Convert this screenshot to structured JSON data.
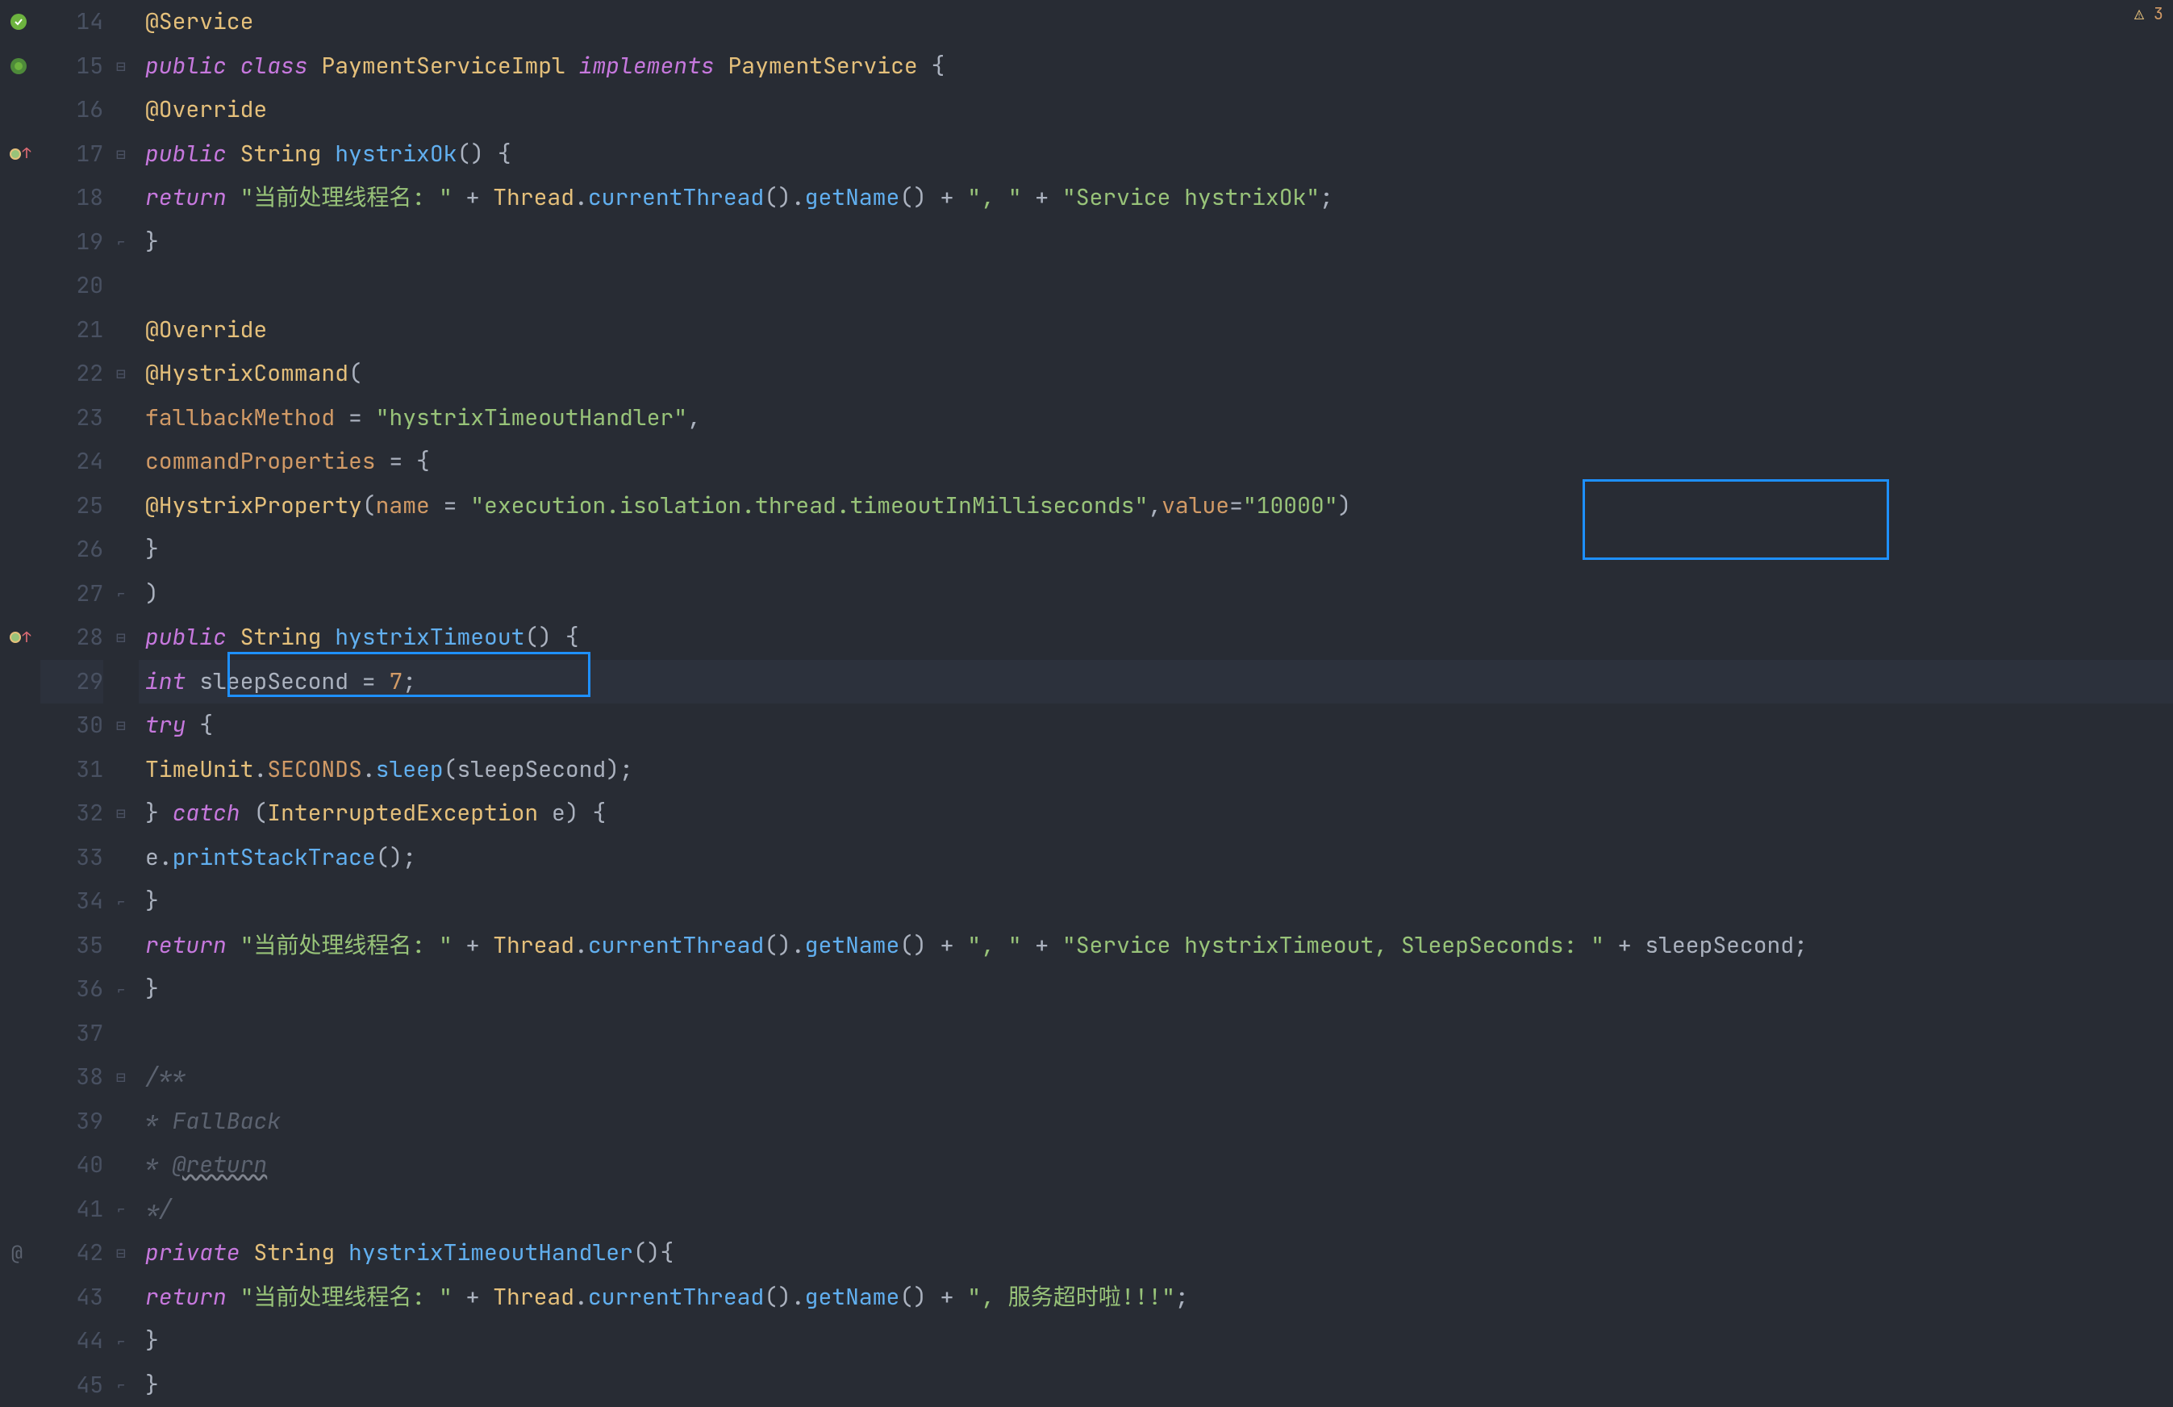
{
  "topRight": {
    "icon": "⚠",
    "count": "3"
  },
  "gutter": {
    "startLine": 14,
    "endLine": 45
  },
  "code": {
    "l14": {
      "anno": "@Service"
    },
    "l15": {
      "kw_public": "public",
      "kw_class": "class",
      "cls": "PaymentServiceImpl",
      "kw_impl": "implements",
      "iface": "PaymentService",
      "brace": " {"
    },
    "l16": {
      "anno": "@Override"
    },
    "l17": {
      "kw": "public",
      "type": "String",
      "fn": "hystrixOk",
      "rest": "() {"
    },
    "l18": {
      "kw": "return",
      "s1": "\"当前处理线程名: \"",
      "plus1": " + ",
      "t1": "Thread",
      "dot1": ".",
      "m1": "currentThread",
      "p1": "().",
      "m2": "getName",
      "p2": "() + ",
      "s2": "\", \"",
      "plus2": " + ",
      "s3": "\"Service hystrixOk\"",
      "semi": ";"
    },
    "l19": {
      "brace": "}"
    },
    "l21": {
      "anno": "@Override"
    },
    "l22": {
      "anno": "@HystrixCommand",
      "paren": "("
    },
    "l23": {
      "param": "fallbackMethod",
      "eq": " = ",
      "val": "\"hystrixTimeoutHandler\"",
      "comma": ","
    },
    "l24": {
      "param": "commandProperties",
      "eq": " = {",
      "brace": ""
    },
    "l25": {
      "anno": "@HystrixProperty",
      "open": "(",
      "p1": "name",
      "eq1": " = ",
      "v1": "\"execution.isolation.thread.timeoutInMilliseconds\"",
      "comma": ",",
      "p2": "value",
      "eq2": "=",
      "v2": "\"10000\"",
      "close": ")"
    },
    "l26": {
      "brace": "}"
    },
    "l27": {
      "paren": ")"
    },
    "l28": {
      "kw": "public",
      "type": "String",
      "fn": "hystrixTimeout",
      "rest": "() {"
    },
    "l29": {
      "kw": "int",
      "var": " sleepSecond = ",
      "num": "7",
      "semi": ";"
    },
    "l30": {
      "kw": "try",
      "brace": " {"
    },
    "l31": {
      "cls": "TimeUnit",
      "dot1": ".",
      "c2": "SECONDS",
      "dot2": ".",
      "fn": "sleep",
      "open": "(",
      "arg": "sleepSecond",
      "close": ");"
    },
    "l32": {
      "brace1": "} ",
      "kw": "catch",
      "open": " (",
      "type": "InterruptedException",
      "var": " e",
      "close": ") {"
    },
    "l33": {
      "var": "e",
      "dot": ".",
      "fn": "printStackTrace",
      "rest": "();"
    },
    "l34": {
      "brace": "}"
    },
    "l35": {
      "kw": "return",
      "s1": "\"当前处理线程名: \"",
      "plus1": " + ",
      "t1": "Thread",
      "dot1": ".",
      "m1": "currentThread",
      "p1": "().",
      "m2": "getName",
      "p2": "() + ",
      "s2": "\", \"",
      "plus2": " + ",
      "s3": "\"Service hystrixTimeout, SleepSeconds: \"",
      "plus3": " + sleepSecond;",
      "semi": ""
    },
    "l36": {
      "brace": "}"
    },
    "l38": {
      "cmt": "/**"
    },
    "l39": {
      "cmt": " * FallBack"
    },
    "l40": {
      "cmt1": " * ",
      "tag": "@return"
    },
    "l41": {
      "cmt": " */"
    },
    "l42": {
      "kw": "private",
      "type": "String",
      "fn": "hystrixTimeoutHandler",
      "rest": "(){"
    },
    "l43": {
      "kw": "return",
      "sp": "  ",
      "s1": "\"当前处理线程名: \"",
      "plus1": " + ",
      "t1": "Thread",
      "dot1": ".",
      "m1": "currentThread",
      "p1": "().",
      "m2": "getName",
      "p2": "() + ",
      "s2": "\", 服务超时啦!!!\"",
      "semi": ";"
    },
    "l44": {
      "brace": "}"
    },
    "l45": {
      "brace": "}"
    }
  }
}
